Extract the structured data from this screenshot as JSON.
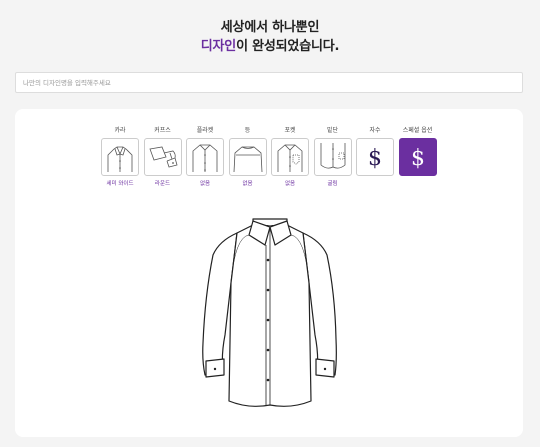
{
  "header": {
    "title_line1": "세상에서 하나뿐인",
    "title_accent": "디자인",
    "title_line2_rest": "이 완성되었습니다."
  },
  "name_input": {
    "value": "",
    "placeholder": "나만의 디자인명을 입력해주세요"
  },
  "options": [
    {
      "category": "카라",
      "value": "세미 와이드",
      "icon": "collar-icon",
      "selected": false
    },
    {
      "category": "커프스",
      "value": "라운드",
      "icon": "cuffs-icon",
      "selected": false
    },
    {
      "category": "플라켓",
      "value": "없음",
      "icon": "placket-icon",
      "selected": false
    },
    {
      "category": "등",
      "value": "없음",
      "icon": "back-icon",
      "selected": false
    },
    {
      "category": "포켓",
      "value": "없음",
      "icon": "pocket-icon",
      "selected": false
    },
    {
      "category": "밑단",
      "value": "굴림",
      "icon": "hem-icon",
      "selected": false
    },
    {
      "category": "자수",
      "value": "",
      "icon": "dollar-icon",
      "selected": false
    },
    {
      "category": "스페셜 옵션",
      "value": "",
      "icon": "dollar-icon",
      "selected": true
    }
  ],
  "colors": {
    "accent": "#6b2fa0",
    "background": "#f4f4f4",
    "card": "#ffffff"
  }
}
